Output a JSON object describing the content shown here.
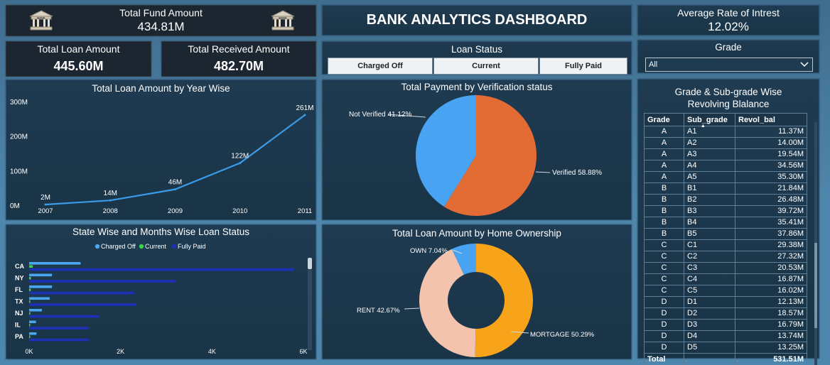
{
  "kpis": {
    "fund_title": "Total Fund Amount",
    "fund_value": "434.81M",
    "loan_title": "Total Loan Amount",
    "loan_value": "445.60M",
    "received_title": "Total Received Amount",
    "received_value": "482.70M",
    "interest_title": "Average Rate of Intrest",
    "interest_value": "12.02%",
    "bank_icon_text": "BANK"
  },
  "header": {
    "title": "BANK ANALYTICS DASHBOARD"
  },
  "loan_status": {
    "title": "Loan Status",
    "tiles": [
      "Charged Off",
      "Current",
      "Fully Paid"
    ]
  },
  "grade": {
    "title": "Grade",
    "selected": "All"
  },
  "line_chart": {
    "title": "Total Loan Amount by Year Wise",
    "y_ticks": [
      "300M",
      "200M",
      "100M",
      "0M"
    ],
    "x_labels": [
      "2007",
      "2008",
      "2009",
      "2010",
      "2011"
    ],
    "data_labels": [
      "2M",
      "14M",
      "46M",
      "122M",
      "261M"
    ],
    "color": "#3a9be8"
  },
  "pie_chart": {
    "title": "Total Payment by Verification status",
    "label_not_verified": "Not Verified 41.12%",
    "label_verified": "Verified 58.88%",
    "colors": {
      "not_verified": "#48a4f2",
      "verified": "#e36b34"
    }
  },
  "bar_chart": {
    "title": "State Wise and Months Wise Loan Status",
    "legend": [
      "Charged Off",
      "Current",
      "Fully Paid"
    ],
    "legend_colors": [
      "#4aa6ee",
      "#3bd14a",
      "#1e2fb8"
    ],
    "states": [
      "CA",
      "NY",
      "FL",
      "TX",
      "NJ",
      "IL",
      "PA"
    ],
    "x_ticks": [
      "0K",
      "2K",
      "4K",
      "6K"
    ]
  },
  "donut_chart": {
    "title": "Total Loan Amount by Home Ownership",
    "label_own": "OWN 7.04%",
    "label_rent": "RENT 42.67%",
    "label_mortgage": "MORTGAGE 50.29%",
    "colors": {
      "own": "#48a4f2",
      "rent": "#f4c3ad",
      "mortgage": "#f8a41a"
    }
  },
  "table": {
    "title_line1": "Grade & Sub-grade Wise",
    "title_line2": "Revolving Blalance",
    "headers": [
      "Grade",
      "Sub_grade",
      "Revol_bal"
    ],
    "rows": [
      [
        "A",
        "A1",
        "11.37M"
      ],
      [
        "A",
        "A2",
        "14.00M"
      ],
      [
        "A",
        "A3",
        "19.54M"
      ],
      [
        "A",
        "A4",
        "34.56M"
      ],
      [
        "A",
        "A5",
        "35.30M"
      ],
      [
        "B",
        "B1",
        "21.84M"
      ],
      [
        "B",
        "B2",
        "26.48M"
      ],
      [
        "B",
        "B3",
        "39.72M"
      ],
      [
        "B",
        "B4",
        "35.41M"
      ],
      [
        "B",
        "B5",
        "37.86M"
      ],
      [
        "C",
        "C1",
        "29.38M"
      ],
      [
        "C",
        "C2",
        "27.32M"
      ],
      [
        "C",
        "C3",
        "20.53M"
      ],
      [
        "C",
        "C4",
        "16.87M"
      ],
      [
        "C",
        "C5",
        "16.02M"
      ],
      [
        "D",
        "D1",
        "12.13M"
      ],
      [
        "D",
        "D2",
        "18.57M"
      ],
      [
        "D",
        "D3",
        "16.79M"
      ],
      [
        "D",
        "D4",
        "13.74M"
      ],
      [
        "D",
        "D5",
        "13.25M"
      ]
    ],
    "total_label": "Total",
    "total_value": "531.51M"
  },
  "chart_data": [
    {
      "type": "line",
      "title": "Total Loan Amount by Year Wise",
      "x": [
        "2007",
        "2008",
        "2009",
        "2010",
        "2011"
      ],
      "values": [
        2,
        14,
        46,
        122,
        261
      ],
      "ylabel": "",
      "ylim": [
        0,
        300
      ],
      "grid": false
    },
    {
      "type": "pie",
      "title": "Total Payment by Verification status",
      "categories": [
        "Not Verified",
        "Verified"
      ],
      "values": [
        41.12,
        58.88
      ]
    },
    {
      "type": "bar",
      "title": "State Wise and Months Wise Loan Status",
      "categories": [
        "CA",
        "NY",
        "FL",
        "TX",
        "NJ",
        "IL",
        "PA"
      ],
      "series": [
        {
          "name": "Charged Off",
          "values": [
            1125,
            500,
            500,
            450,
            280,
            150,
            160
          ]
        },
        {
          "name": "Current",
          "values": [
            80,
            40,
            35,
            25,
            25,
            20,
            15
          ]
        },
        {
          "name": "Fully Paid",
          "values": [
            5800,
            3200,
            2300,
            2350,
            1530,
            1300,
            1300
          ]
        }
      ],
      "xlim": [
        0,
        6000
      ],
      "legend": "top"
    },
    {
      "type": "pie",
      "title": "Total Loan Amount by Home Ownership",
      "categories": [
        "MORTGAGE",
        "RENT",
        "OWN"
      ],
      "values": [
        50.29,
        42.67,
        7.04
      ]
    }
  ]
}
